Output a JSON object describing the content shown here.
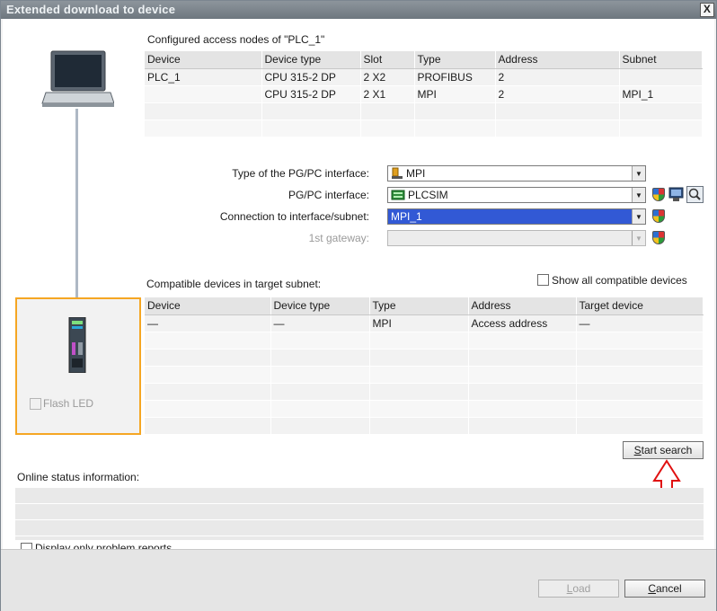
{
  "window": {
    "title": "Extended download to device",
    "close": "X"
  },
  "access_nodes": {
    "heading": "Configured access nodes of \"PLC_1\"",
    "columns": [
      "Device",
      "Device type",
      "Slot",
      "Type",
      "Address",
      "Subnet"
    ],
    "rows": [
      [
        "PLC_1",
        "CPU 315-2 DP",
        "2 X2",
        "PROFIBUS",
        "2",
        ""
      ],
      [
        "",
        "CPU 315-2 DP",
        "2 X1",
        "MPI",
        "2",
        "MPI_1"
      ],
      [
        "",
        "",
        "",
        "",
        "",
        ""
      ],
      [
        "",
        "",
        "",
        "",
        "",
        ""
      ]
    ]
  },
  "interface": {
    "type_label": "Type of the PG/PC interface:",
    "type_value": "MPI",
    "pgpc_label": "PG/PC interface:",
    "pgpc_value": "PLCSIM",
    "connection_label": "Connection to interface/subnet:",
    "connection_value": "MPI_1",
    "gateway_label": "1st gateway:",
    "gateway_value": ""
  },
  "compatible": {
    "heading": "Compatible devices in target subnet:",
    "show_all_label": "Show all compatible devices",
    "columns": [
      "Device",
      "Device type",
      "Type",
      "Address",
      "Target device"
    ],
    "rows": [
      [
        "—",
        "—",
        "MPI",
        "Access address",
        "—"
      ],
      [
        "",
        "",
        "",
        "",
        ""
      ],
      [
        "",
        "",
        "",
        "",
        ""
      ],
      [
        "",
        "",
        "",
        "",
        ""
      ],
      [
        "",
        "",
        "",
        "",
        ""
      ],
      [
        "",
        "",
        "",
        "",
        ""
      ],
      [
        "",
        "",
        "",
        "",
        ""
      ]
    ]
  },
  "flash_led_label": "Flash LED",
  "start_search": {
    "prefix": "",
    "underline": "S",
    "rest": "tart search"
  },
  "online_status": {
    "heading": "Online status information:",
    "problem_reports_label": "Display only problem reports"
  },
  "footer": {
    "load": {
      "underline": "L",
      "rest": "oad"
    },
    "cancel": {
      "underline": "C",
      "rest": "ancel"
    }
  },
  "colors": {
    "highlight": "#f5a623",
    "selection": "#3259d5",
    "annotation_arrow": "#e01010"
  },
  "icons": [
    "laptop-icon",
    "plc-device-icon",
    "mpi-icon",
    "plcsim-icon",
    "shield-icon",
    "properties-icon",
    "diagnostics-icon",
    "red-up-arrow"
  ]
}
